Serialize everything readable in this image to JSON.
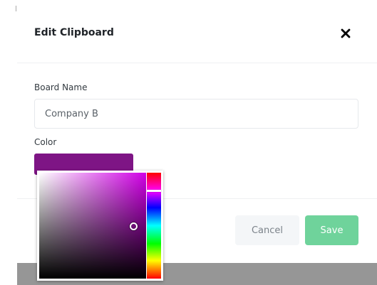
{
  "dialog": {
    "title": "Edit Clipboard",
    "close_icon": "close-icon"
  },
  "form": {
    "board_name_label": "Board Name",
    "board_name_value": "Company B",
    "color_label": "Color"
  },
  "colors": {
    "selected": "#7e1585",
    "picker_hue": "#d100e6",
    "save_button": "#6fd39b",
    "cancel_button": "#f4f6f8"
  },
  "footer": {
    "cancel_label": "Cancel",
    "save_label": "Save"
  }
}
